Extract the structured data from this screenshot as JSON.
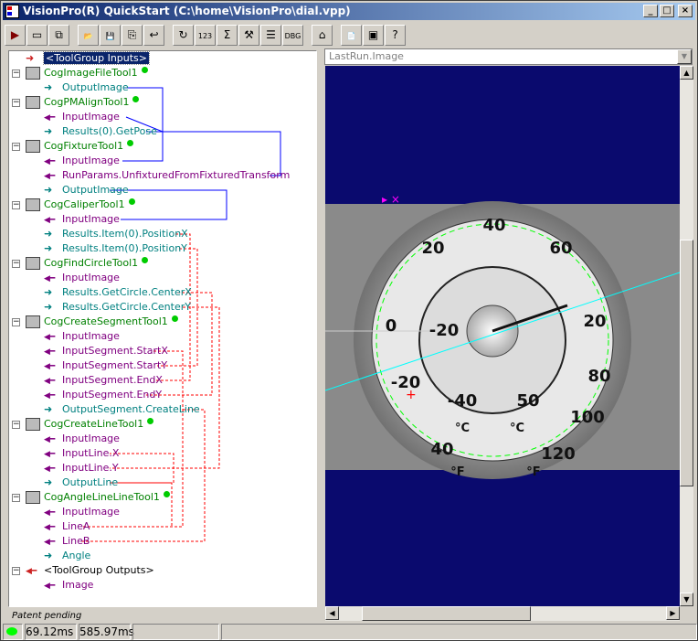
{
  "window": {
    "title": "VisionPro(R) QuickStart (C:\\home\\VisionPro\\dial.vpp)",
    "minimize": "_",
    "maximize": "□",
    "close": "×"
  },
  "toolbar": [
    {
      "icon": "run-icon",
      "g": "▶"
    },
    {
      "icon": "image-display-icon",
      "g": "▭"
    },
    {
      "icon": "show-edit-icon",
      "g": "⧉"
    },
    {
      "icon": "open-folder-icon",
      "g": "📂"
    },
    {
      "icon": "save-icon",
      "g": "💾"
    },
    {
      "icon": "save-as-icon",
      "g": "⎘"
    },
    {
      "icon": "import-icon",
      "g": "↩"
    },
    {
      "icon": "reset-icon",
      "g": "↻"
    },
    {
      "icon": "terminal-icon",
      "g": "123"
    },
    {
      "icon": "variables-icon",
      "g": "Σ"
    },
    {
      "icon": "tools-icon",
      "g": "⚒"
    },
    {
      "icon": "results-icon",
      "g": "☰"
    },
    {
      "icon": "debug-icon",
      "g": "DBG"
    },
    {
      "icon": "calibrate-icon",
      "g": "⌂"
    },
    {
      "icon": "script-icon",
      "g": "📄"
    },
    {
      "icon": "presentation-icon",
      "g": "▣"
    },
    {
      "icon": "help-icon",
      "g": "?"
    }
  ],
  "tree": [
    {
      "t": "<ToolGroup Inputs>",
      "k": "sel",
      "lv": 0,
      "a": "in-arrow"
    },
    {
      "t": "CogImageFileTool1",
      "k": "tool",
      "lv": 0
    },
    {
      "t": "OutputImage",
      "k": "out",
      "lv": 1
    },
    {
      "t": "CogPMAlignTool1",
      "k": "tool",
      "lv": 0
    },
    {
      "t": "InputImage",
      "k": "in",
      "lv": 1
    },
    {
      "t": "Results(0).GetPose",
      "k": "out",
      "lv": 1
    },
    {
      "t": "CogFixtureTool1",
      "k": "tool",
      "lv": 0
    },
    {
      "t": "InputImage",
      "k": "in",
      "lv": 1
    },
    {
      "t": "RunParams.UnfixturedFromFixturedTransform",
      "k": "in",
      "lv": 1
    },
    {
      "t": "OutputImage",
      "k": "out",
      "lv": 1
    },
    {
      "t": "CogCaliperTool1",
      "k": "tool",
      "lv": 0
    },
    {
      "t": "InputImage",
      "k": "in",
      "lv": 1
    },
    {
      "t": "Results.Item(0).PositionX",
      "k": "out",
      "lv": 1
    },
    {
      "t": "Results.Item(0).PositionY",
      "k": "out",
      "lv": 1
    },
    {
      "t": "CogFindCircleTool1",
      "k": "tool",
      "lv": 0
    },
    {
      "t": "InputImage",
      "k": "in",
      "lv": 1
    },
    {
      "t": "Results.GetCircle.CenterX",
      "k": "out",
      "lv": 1
    },
    {
      "t": "Results.GetCircle.CenterY",
      "k": "out",
      "lv": 1
    },
    {
      "t": "CogCreateSegmentTool1",
      "k": "tool",
      "lv": 0
    },
    {
      "t": "InputImage",
      "k": "in",
      "lv": 1
    },
    {
      "t": "InputSegment.StartX",
      "k": "in",
      "lv": 1
    },
    {
      "t": "InputSegment.StartY",
      "k": "in",
      "lv": 1
    },
    {
      "t": "InputSegment.EndX",
      "k": "in",
      "lv": 1
    },
    {
      "t": "InputSegment.EndY",
      "k": "in",
      "lv": 1
    },
    {
      "t": "OutputSegment.CreateLine",
      "k": "out",
      "lv": 1
    },
    {
      "t": "CogCreateLineTool1",
      "k": "tool",
      "lv": 0
    },
    {
      "t": "InputImage",
      "k": "in",
      "lv": 1
    },
    {
      "t": "InputLine.X",
      "k": "in",
      "lv": 1
    },
    {
      "t": "InputLine.Y",
      "k": "in",
      "lv": 1
    },
    {
      "t": "OutputLine",
      "k": "out",
      "lv": 1
    },
    {
      "t": "CogAngleLineLineTool1",
      "k": "tool",
      "lv": 0
    },
    {
      "t": "InputImage",
      "k": "in",
      "lv": 1
    },
    {
      "t": "LineA",
      "k": "in",
      "lv": 1
    },
    {
      "t": "LineB",
      "k": "in",
      "lv": 1
    },
    {
      "t": "Angle",
      "k": "out",
      "lv": 1
    },
    {
      "t": "<ToolGroup Outputs>",
      "k": "grp",
      "lv": 0
    },
    {
      "t": "Image",
      "k": "in",
      "lv": 1
    }
  ],
  "patent": "Patent pending",
  "display": {
    "selector": "LastRun.Image",
    "dial_labels": [
      "40",
      "60",
      "20",
      "0",
      "-20",
      "-20",
      "-40",
      "20",
      "50",
      "80",
      "100",
      "120",
      "40",
      "°C",
      "°C",
      "°F",
      "°F"
    ]
  },
  "status": {
    "indicator_color": "#00ff00",
    "time1": "69.12ms",
    "time2": "585.97ms",
    "p3": "",
    "p4": ""
  },
  "colors": {
    "tool": "#008000",
    "input": "#800080",
    "output": "#008080",
    "link_solid": "#0000ff",
    "link_dashed": "#ff0000",
    "display_bg": "#0a0a6e"
  }
}
